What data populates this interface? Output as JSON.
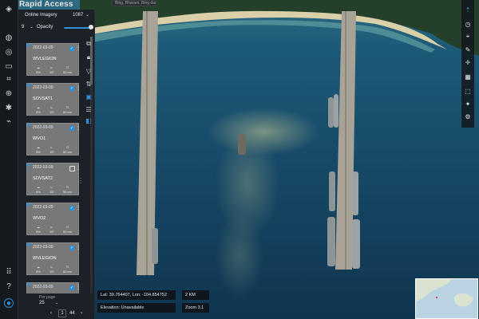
{
  "app": {
    "brand": "Rapid Access",
    "search_placeholder": "Bing, Bharam, Bing dashboard"
  },
  "panel": {
    "title": "Online Imagery",
    "count": "1087",
    "band": "9",
    "opacity_label": "Opacity",
    "opacity_value": 1.0
  },
  "imagery": [
    {
      "date": "2022-03-09",
      "name": "WVLEGION",
      "cloud": "3%",
      "off_nadir": "15°",
      "gsd": "50 cm",
      "selected": true
    },
    {
      "date": "2022-03-09",
      "name": "SOVSAT1",
      "cloud": "3%",
      "off_nadir": "15°",
      "gsd": "50 cm",
      "selected": true
    },
    {
      "date": "2022-03-09",
      "name": "WVO1",
      "cloud": "3%",
      "off_nadir": "15°",
      "gsd": "50 cm",
      "selected": true
    },
    {
      "date": "2022-03-09",
      "name": "SOVSAT2",
      "cloud": "3%",
      "off_nadir": "15°",
      "gsd": "50 cm",
      "selected": false
    },
    {
      "date": "2022-03-09",
      "name": "WVO2",
      "cloud": "3%",
      "off_nadir": "15°",
      "gsd": "50 cm",
      "selected": true
    },
    {
      "date": "2022-03-09",
      "name": "WVLEGION",
      "cloud": "3%",
      "off_nadir": "15°",
      "gsd": "50 cm",
      "selected": true
    },
    {
      "date": "2022-03-09",
      "name": "",
      "cloud": "",
      "off_nadir": "",
      "gsd": "",
      "selected": true
    }
  ],
  "pager": {
    "label": "Per page",
    "page_size": "25",
    "current_page": "1",
    "total_pages": "44"
  },
  "status": {
    "coords": "Lat: 39.764407, Lon: -104.854752",
    "scale": "2 KM",
    "elevation": "Elevation: Unavailable",
    "zoom": "Zoom 3.1"
  },
  "icons": {
    "rail": [
      "layers-icon",
      "globe-icon",
      "location-icon",
      "folder-icon",
      "crop-icon",
      "target-icon",
      "settings-icon",
      "analytics-icon",
      "grid-icon",
      "help-icon",
      "user-icon"
    ],
    "tools": [
      "copy-icon",
      "lock-icon",
      "filter-icon",
      "sort-icon",
      "grid-view-icon",
      "list-view-icon",
      "panel-icon"
    ],
    "right": [
      "compass-icon",
      "history-icon",
      "camera-icon",
      "pencil-icon",
      "crosshair-icon",
      "grid-icon",
      "edit-icon",
      "sparkle-icon",
      "gear-icon"
    ]
  },
  "colors": {
    "accent": "#2f8fd8",
    "panel": "#1b2126",
    "card": "#787878",
    "water": "#1b4a6a"
  }
}
